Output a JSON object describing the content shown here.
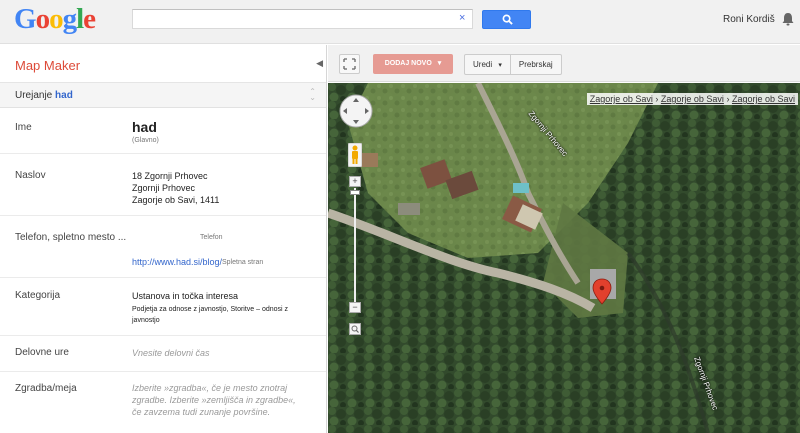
{
  "header": {
    "logo": "Google",
    "search": {
      "value": "",
      "clear": "×"
    },
    "user_name": "Roni Kordiš"
  },
  "sidebar": {
    "title": "Map Maker",
    "collapse": "◀",
    "edit_prefix": "Urejanje",
    "edit_target": "had",
    "rows": {
      "name": {
        "label": "Ime",
        "value": "had",
        "sub": "(Glavno)"
      },
      "address": {
        "label": "Naslov",
        "line1": "18  Zgornji Prhovec",
        "line2": "Zgornji Prhovec",
        "line3": "Zagorje ob Savi, 1411"
      },
      "phone": {
        "label": "Telefon, spletno mesto ...",
        "phone_hint": "Telefon",
        "url": "http://www.had.si/blog/",
        "url_hint": "Spletna stran"
      },
      "category": {
        "label": "Kategorija",
        "value": "Ustanova in točka interesa",
        "sub": "Podjetja za odnose z javnostjo, Storitve – odnosi z javnostjo"
      },
      "hours": {
        "label": "Delovne ure",
        "placeholder": "Vnesite delovni čas"
      },
      "building": {
        "label": "Zgradba/meja",
        "hint": "Izberite »zgradba«, če je mesto znotraj zgradbe. Izberite »zemljišča in zgradbe«, če zavzema tudi zunanje površine."
      }
    }
  },
  "map": {
    "toolbar": {
      "add_new": "DODAJ NOVO",
      "add_new_caret": "▾",
      "edit": "Uredi",
      "edit_caret": "▾",
      "count": "Prebrskaj"
    },
    "breadcrumb": {
      "item1": "Zagorje ob Savi",
      "sep": "›",
      "item2": "Zagorje ob Savi",
      "item3": "Zagorje ob Savi"
    },
    "zoom_in": "+",
    "zoom_out": "−",
    "road_labels": [
      "Zgornji Prhovec",
      "Zgornji Prhovec"
    ]
  },
  "colors": {
    "accent": "#dd4b39",
    "link": "#3366cc",
    "search_blue": "#4285f4",
    "add_new": "#e69b93"
  }
}
